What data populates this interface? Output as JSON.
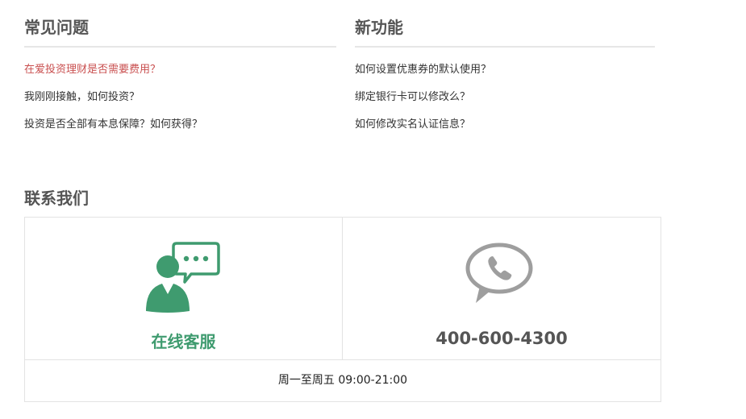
{
  "faq": {
    "title": "常见问题",
    "items": [
      {
        "label": "在爱投资理财是否需要费用？"
      },
      {
        "label": "我刚刚接触，如何投资？"
      },
      {
        "label": "投资是否全部有本息保障？如何获得？"
      }
    ]
  },
  "new_features": {
    "title": "新功能",
    "items": [
      {
        "label": "如何设置优惠券的默认使用？"
      },
      {
        "label": "绑定银行卡可以修改么？"
      },
      {
        "label": "如何修改实名认证信息？"
      }
    ]
  },
  "contact": {
    "title": "联系我们",
    "online_service_label": "在线客服",
    "phone_number": "400-600-4300",
    "hours": "周一至周五 09:00-21:00"
  },
  "colors": {
    "accent_green": "#3f9b6f",
    "active_link_red": "#c94f4f",
    "phone_icon_gray": "#9e9e9e"
  },
  "icons": {
    "online_service": "customer-service-agent-icon",
    "phone": "phone-speech-bubble-icon"
  }
}
